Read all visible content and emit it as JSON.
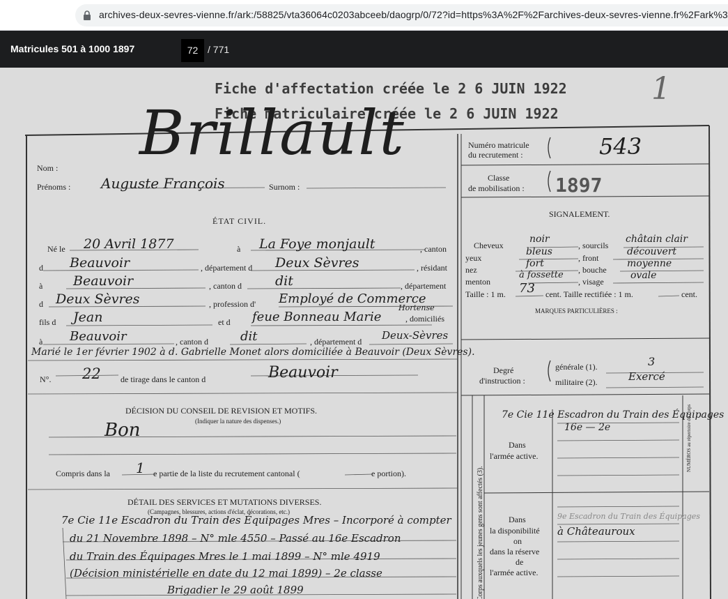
{
  "browser": {
    "url": "archives-deux-sevres-vienne.fr/ark:/58825/vta36064c0203abceeb/daogrp/0/72?id=https%3A%2F%2Farchives-deux-sevres-vienne.fr%2Fark%3A..."
  },
  "viewer": {
    "title": "Matricules 501 à 1000 1897",
    "current_page": "72",
    "total_pages": "/ 771"
  },
  "document": {
    "corner_number": "1",
    "stamp_affectation": "Fiche d'affectation créée le 2 6 JUIN 1922",
    "stamp_matricule": "Fiche matriculaire créée le 2 6 JUIN 1922",
    "surname_handwritten": "Brillault",
    "labels": {
      "nom": "Nom :",
      "prenoms": "Prénoms :",
      "surnom": "Surnom :",
      "etat_civil": "ÉTAT CIVIL.",
      "ne_le": "Né le",
      "a": "à",
      "canton": ", canton",
      "de": "d",
      "departement_d": ", département d",
      "residant": ", résidant",
      "canton_d": ", canton d",
      "departement": ", département",
      "profession_d": ", profession d'",
      "fils_d": "fils d",
      "et_d": "et d",
      "domicilies": ", domiciliés",
      "numero": "N°.",
      "tirage": "de tirage dans le canton d",
      "decision_title": "DÉCISION DU CONSEIL DE REVISION ET MOTIFS.",
      "decision_sub": "(Indiquer la nature des dispenses.)",
      "compris": "Compris dans la",
      "partie": "e partie de la liste du recrutement cantonal (",
      "portion": "e portion).",
      "detail_title": "DÉTAIL DES SERVICES ET MUTATIONS DIVERSES.",
      "detail_sub": "(Campagnes, blessures, actions d'éclat, décorations, etc.)",
      "numero_matricule": "Numéro matricule",
      "du_recrutement": "du recrutement :",
      "classe": "Classe",
      "de_mobilisation": "de mobilisation :",
      "signalement": "SIGNALEMENT.",
      "cheveux": "Cheveux",
      "sourcils": ", sourcils",
      "yeux": "yeux",
      "front": ", front",
      "nez": "nez",
      "bouche": ", bouche",
      "menton": "menton",
      "visage": ", visage",
      "taille": "Taille : 1 m.",
      "taille_rectifiee": "cent. Taille rectifiée : 1 m.",
      "cent": "cent.",
      "marques": "MARQUES PARTICULIÈRES :",
      "degre": "Degré",
      "instruction": "d'instruction :",
      "generale": "générale (1).",
      "militaire": "militaire (2).",
      "armee_active_1": "Dans",
      "armee_active_2": "l'armée active.",
      "dispo_1": "Dans",
      "dispo_2": "la disponibilité",
      "dispo_3": "on",
      "dispo_4": "dans la réserve",
      "dispo_5": "de",
      "dispo_6": "l'armée active.",
      "corps_side": "Corps auxquels les jeunes gens sont affectés (3).",
      "numero_side": "NUMÉROS au répertoire du corps"
    },
    "handwritten": {
      "prenoms": "Auguste François",
      "date_naissance": "20 Avril 1877",
      "lieu_naissance": "La Foye monjault",
      "canton": "Beauvoir",
      "departement": "Deux Sèvres",
      "residence": "Beauvoir",
      "canton_residence": "dit",
      "departement_residence": "Deux Sèvres",
      "profession": "Employé de Commerce",
      "pere": "Jean",
      "mere": "feue Bonneau Marie",
      "mere_prenom_extra": "Hortense",
      "domicile": "Beauvoir",
      "domicile_canton": "dit",
      "domicile_departement": "Deux-Sèvres",
      "mariage": "Marié le 1er février 1902 à d. Gabrielle Monet alors domiciliée à Beauvoir (Deux Sèvres).",
      "numero_tirage": "22",
      "canton_tirage": "Beauvoir",
      "decision": "Bon",
      "partie": "1",
      "numero_matricule": "543",
      "classe": "1897",
      "cheveux": "noir",
      "sourcils": "châtain clair",
      "yeux": "bleus",
      "front": "découvert",
      "nez": "fort",
      "bouche": "moyenne",
      "menton": "à fossette",
      "visage": "ovale",
      "taille": "73",
      "instruction_generale": "3",
      "instruction_militaire": "Exercé",
      "service_1": "7e Cie 11e Escadron du Train des Équipages",
      "service_1b": "16e — 2e",
      "service_2": "9e Escadron du Train des Équipages",
      "service_2b": "à Châteauroux",
      "detail_1": "7e Cie 11e Escadron du Train des Équipages Mres – Incorporé à compter",
      "detail_2": "du 21 Novembre 1898 – N° mle 4550 – Passé au 16e Escadron",
      "detail_3": "du Train des Équipages Mres le 1 mai 1899 – N° mle 4919",
      "detail_4": "(Décision ministérielle en date du 12 mai 1899) – 2e classe",
      "detail_5": "Brigadier le 29 août 1899"
    }
  }
}
